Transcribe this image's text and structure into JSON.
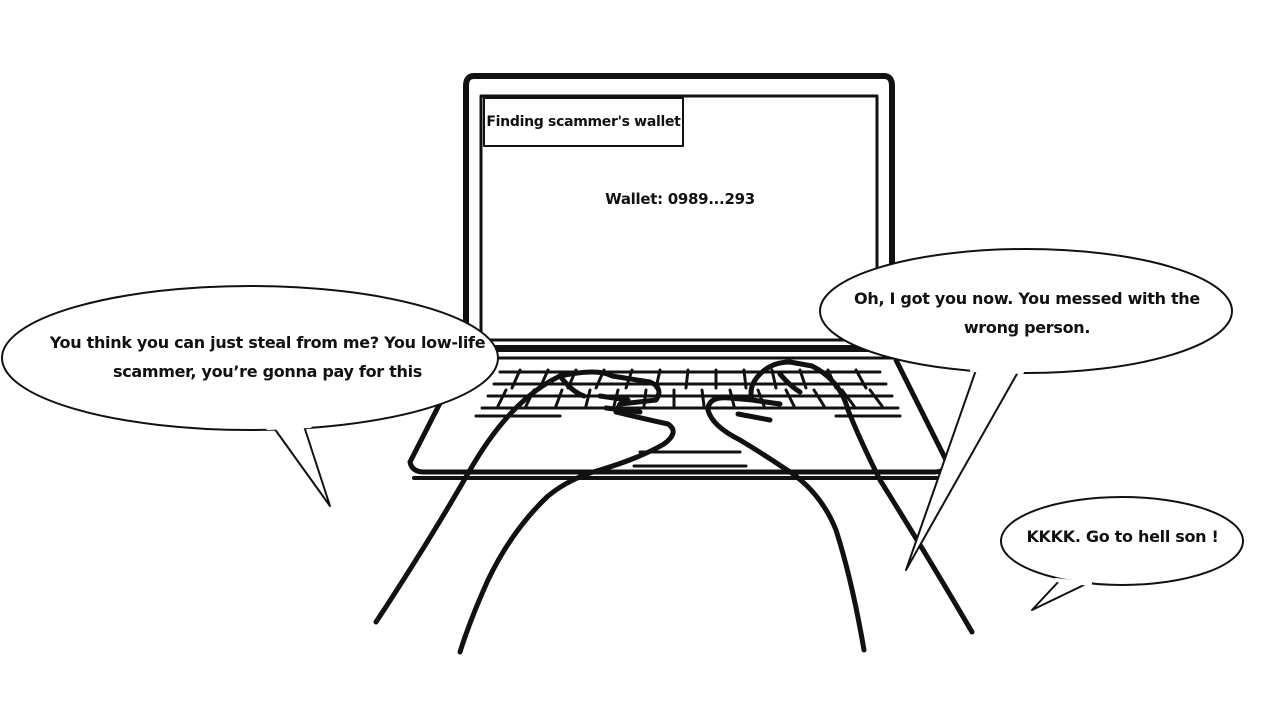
{
  "scene": {
    "screen_title": "Finding scammer's wallet",
    "wallet_text": "Wallet: 0989...293",
    "bubble_left": "You think you can just steal from me? You low-life scammer, you’re gonna pay for this",
    "bubble_right": "Oh, I got you now. You messed with the wrong person.",
    "bubble_small": "KKKK. Go to hell son !"
  },
  "colors": {
    "ink": "#111111",
    "background": "#ffffff"
  },
  "icons": [
    "laptop-illustration",
    "typing-hands-illustration",
    "speech-bubble"
  ]
}
